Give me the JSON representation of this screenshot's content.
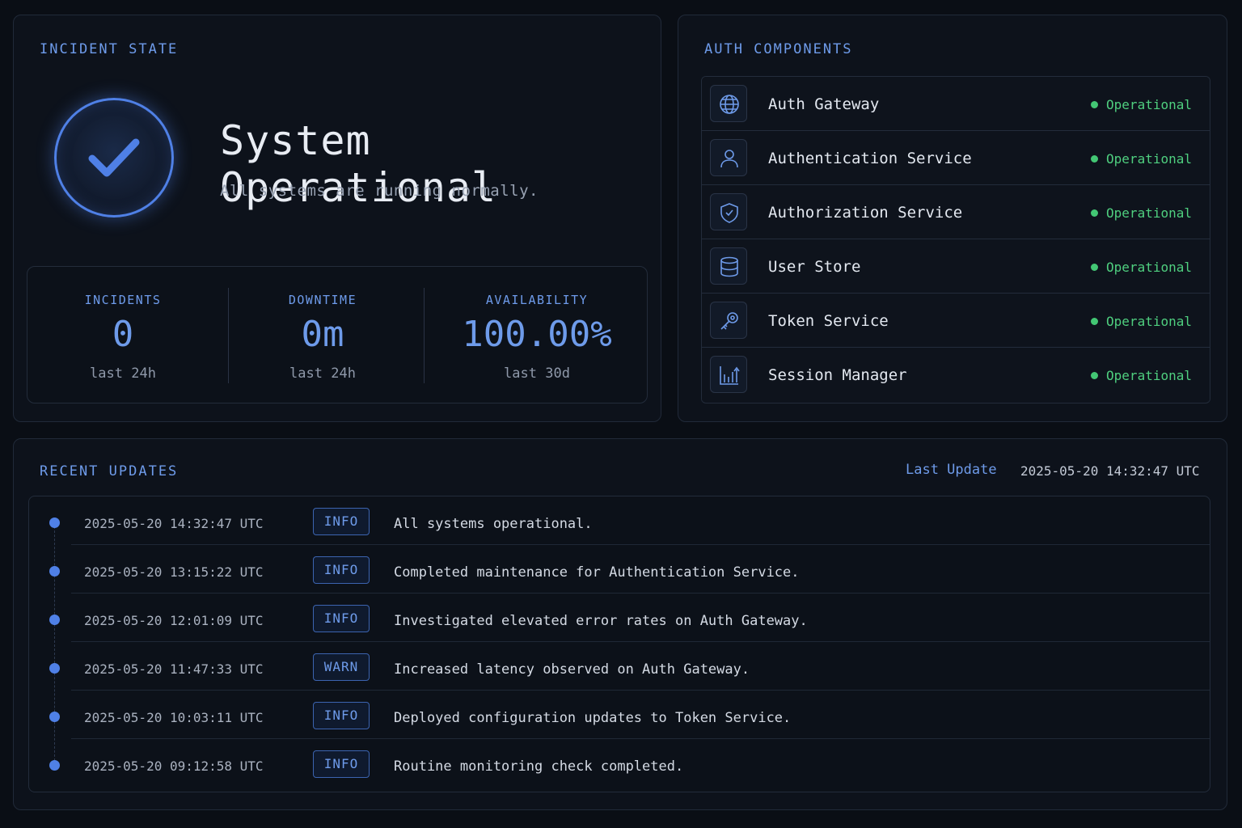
{
  "incident": {
    "panel_title": "INCIDENT STATE",
    "status_title": "System Operational",
    "status_subtitle": "All systems are running normally.",
    "stats": [
      {
        "label": "INCIDENTS",
        "value": "0",
        "sub": "last 24h"
      },
      {
        "label": "DOWNTIME",
        "value": "0m",
        "sub": "last 24h"
      },
      {
        "label": "AVAILABILITY",
        "value": "100.00%",
        "sub": "last 30d"
      }
    ]
  },
  "components": {
    "panel_title": "AUTH COMPONENTS",
    "items": [
      {
        "name": "Auth Gateway",
        "status": "Operational",
        "icon": "globe-icon"
      },
      {
        "name": "Authentication Service",
        "status": "Operational",
        "icon": "user-icon"
      },
      {
        "name": "Authorization Service",
        "status": "Operational",
        "icon": "shield-check-icon"
      },
      {
        "name": "User Store",
        "status": "Operational",
        "icon": "database-icon"
      },
      {
        "name": "Token Service",
        "status": "Operational",
        "icon": "key-icon"
      },
      {
        "name": "Session Manager",
        "status": "Operational",
        "icon": "bar-chart-icon"
      }
    ]
  },
  "updates": {
    "panel_title": "RECENT UPDATES",
    "last_update_label": "Last Update",
    "last_update_value": "2025-05-20 14:32:47 UTC",
    "items": [
      {
        "time": "2025-05-20 14:32:47 UTC",
        "level": "INFO",
        "message": "All systems operational."
      },
      {
        "time": "2025-05-20 13:15:22 UTC",
        "level": "INFO",
        "message": "Completed maintenance for Authentication Service."
      },
      {
        "time": "2025-05-20 12:01:09 UTC",
        "level": "INFO",
        "message": "Investigated elevated error rates on Auth Gateway."
      },
      {
        "time": "2025-05-20 11:47:33 UTC",
        "level": "WARN",
        "message": "Increased latency observed on Auth Gateway."
      },
      {
        "time": "2025-05-20 10:03:11 UTC",
        "level": "INFO",
        "message": "Deployed configuration updates to Token Service."
      },
      {
        "time": "2025-05-20 09:12:58 UTC",
        "level": "INFO",
        "message": "Routine monitoring check completed."
      }
    ]
  },
  "colors": {
    "accent": "#6e9bea",
    "operational": "#4fcf7f",
    "background": "#0a0e15"
  }
}
